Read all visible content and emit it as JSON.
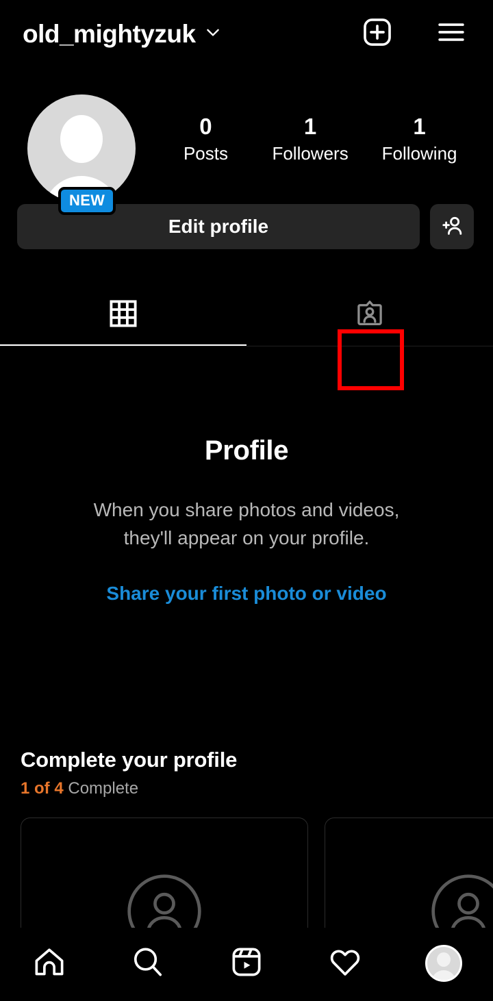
{
  "header": {
    "username": "old_mightyzuk",
    "chevron_icon": "chevron-down-icon",
    "new_post_icon": "new-post-plus-icon",
    "menu_icon": "hamburger-menu-icon"
  },
  "profile": {
    "avatar_icon": "default-avatar-icon",
    "new_badge": "NEW",
    "stats": [
      {
        "value": "0",
        "label": "Posts"
      },
      {
        "value": "1",
        "label": "Followers"
      },
      {
        "value": "1",
        "label": "Following"
      }
    ]
  },
  "actions": {
    "edit_profile_label": "Edit profile",
    "add_person_icon": "add-person-icon"
  },
  "tabs": [
    {
      "name": "grid",
      "icon": "grid-icon",
      "active": true
    },
    {
      "name": "tagged",
      "icon": "tagged-profile-card-icon",
      "active": false,
      "highlighted": true
    }
  ],
  "empty_state": {
    "title": "Profile",
    "description_line1": "When you share photos and videos,",
    "description_line2": "they'll appear on your profile.",
    "link_label": "Share your first photo or video"
  },
  "complete_profile": {
    "title": "Complete your profile",
    "progress_count": "1 of 4",
    "progress_word": "Complete",
    "cards": [
      {
        "icon": "person-outline-circle-icon"
      },
      {
        "icon": "person-outline-circle-icon"
      }
    ]
  },
  "bottom_nav": [
    {
      "name": "home",
      "icon": "home-icon"
    },
    {
      "name": "search",
      "icon": "search-icon"
    },
    {
      "name": "reels",
      "icon": "reels-icon"
    },
    {
      "name": "activity",
      "icon": "heart-icon"
    },
    {
      "name": "profile",
      "icon": "profile-avatar-icon"
    }
  ],
  "colors": {
    "background": "#000000",
    "accent_blue": "#1a8cd8",
    "badge_blue": "#0f8ce0",
    "orange": "#e8762b",
    "highlight_red": "#ff0000",
    "button_gray": "#262626"
  }
}
